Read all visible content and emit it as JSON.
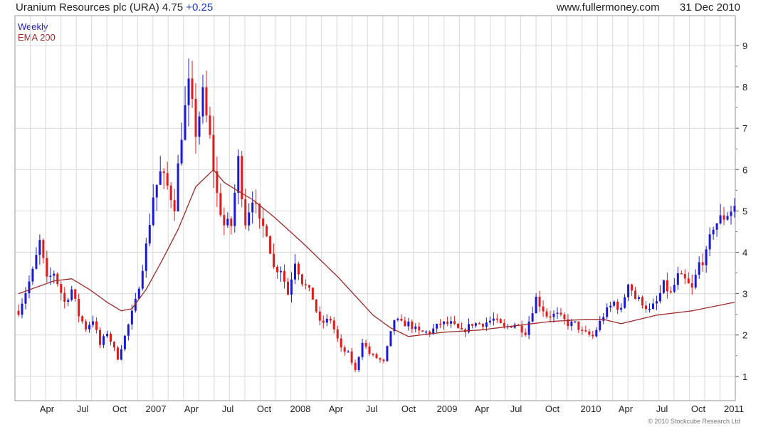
{
  "header": {
    "title": "Uranium Resources plc (URA)",
    "price": "4.75",
    "change": "+0.25",
    "source": "www.fullermoney.com",
    "date": "31 Dec 2010"
  },
  "legend": {
    "frequency": "Weekly",
    "indicator": "EMA 200"
  },
  "copyright": "© 2010 Stockcube Research Ltd",
  "colors": {
    "up": "#1a1ad4",
    "down": "#e01b1b",
    "ema": "#a02828",
    "grid": "#d9d9d9"
  },
  "chart_data": {
    "type": "bar",
    "style": "weekly OHLC bars (blue = up week, red = down week) with EMA 200 line",
    "x_tick_labels": [
      "Apr",
      "Jul",
      "Oct",
      "2007",
      "Apr",
      "Jul",
      "Oct",
      "2008",
      "Apr",
      "Jul",
      "Oct",
      "2009",
      "Apr",
      "Jul",
      "Oct",
      "2010",
      "Apr",
      "Jul",
      "Oct",
      "2011"
    ],
    "y_ticks": [
      1,
      2,
      3,
      4,
      5,
      6,
      7,
      8,
      9
    ],
    "ylim": [
      0.2,
      9.2
    ],
    "grid": true,
    "y_axis_side": "right",
    "price_anchors": {
      "week": [
        0,
        4,
        6,
        8,
        10,
        13,
        15,
        17,
        19,
        21,
        23,
        25,
        28,
        30,
        33,
        36,
        38,
        40,
        42,
        44,
        46,
        48,
        50,
        52,
        54,
        56,
        58,
        60,
        62,
        64,
        66,
        68,
        70,
        72,
        74,
        76,
        78,
        80,
        83,
        85,
        88,
        91,
        93,
        95,
        97,
        99,
        101,
        103,
        106,
        108,
        110,
        113,
        116,
        119,
        122,
        125,
        128,
        131,
        134,
        137,
        140,
        143,
        146,
        149,
        152,
        155,
        157,
        159,
        162,
        165,
        168,
        170,
        172,
        174,
        176,
        178,
        180,
        182,
        184,
        186,
        188,
        190,
        192,
        194,
        196,
        199,
        202
      ],
      "close": [
        2.3,
        3.2,
        3.9,
        3.0,
        3.2,
        2.5,
        2.8,
        2.2,
        1.9,
        2.1,
        1.5,
        1.8,
        1.2,
        1.7,
        2.5,
        3.8,
        5.0,
        5.5,
        5.2,
        4.8,
        6.5,
        7.5,
        6.5,
        7.3,
        6.3,
        5.0,
        4.3,
        4.3,
        5.8,
        4.4,
        5.0,
        4.3,
        4.2,
        3.3,
        3.3,
        2.7,
        3.5,
        3.0,
        2.6,
        2.0,
        2.1,
        1.4,
        1.3,
        0.9,
        1.6,
        1.3,
        1.2,
        1.1,
        2.1,
        2.0,
        2.0,
        1.8,
        1.8,
        2.0,
        2.0,
        1.8,
        2.0,
        2.0,
        2.1,
        1.9,
        2.0,
        1.8,
        2.6,
        2.2,
        2.2,
        2.0,
        2.0,
        1.8,
        1.7,
        2.2,
        2.5,
        2.3,
        3.0,
        2.6,
        2.5,
        2.3,
        2.5,
        2.9,
        2.7,
        3.1,
        3.0,
        2.8,
        3.4,
        3.6,
        4.3,
        4.5,
        4.75
      ]
    },
    "ema_200_anchors": {
      "week": [
        0,
        10,
        15,
        20,
        25,
        29,
        32,
        36,
        40,
        45,
        50,
        55,
        58,
        62,
        66,
        72,
        80,
        90,
        100,
        105,
        110,
        120,
        130,
        140,
        150,
        160,
        165,
        170,
        180,
        190,
        202
      ],
      "value": [
        2.7,
        3.0,
        3.05,
        2.8,
        2.5,
        2.3,
        2.35,
        2.8,
        3.4,
        4.2,
        5.2,
        5.6,
        5.3,
        5.1,
        4.9,
        4.5,
        3.9,
        3.1,
        2.2,
        1.9,
        1.7,
        1.8,
        1.85,
        1.95,
        2.05,
        2.1,
        2.1,
        2.0,
        2.2,
        2.3,
        2.5
      ]
    }
  }
}
